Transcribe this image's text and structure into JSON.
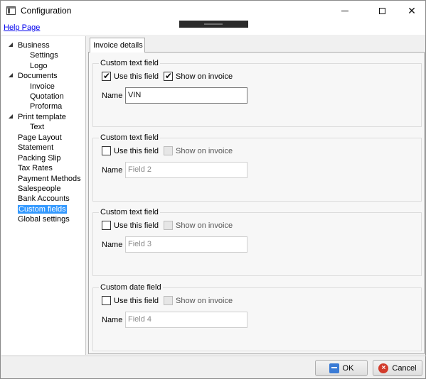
{
  "window": {
    "title": "Configuration",
    "controls": {
      "minimize": "–",
      "maximize": "□",
      "close": "✕"
    }
  },
  "help": {
    "link_label": "Help Page"
  },
  "tree": {
    "items": [
      {
        "label": "Business",
        "level": 0,
        "expanded": true
      },
      {
        "label": "Settings",
        "level": 1
      },
      {
        "label": "Logo",
        "level": 1
      },
      {
        "label": "Documents",
        "level": 0,
        "expanded": true
      },
      {
        "label": "Invoice",
        "level": 1
      },
      {
        "label": "Quotation",
        "level": 1
      },
      {
        "label": "Proforma",
        "level": 1
      },
      {
        "label": "Print template",
        "level": 0,
        "expanded": true
      },
      {
        "label": "Text",
        "level": 1
      },
      {
        "label": "Page Layout",
        "level": 0
      },
      {
        "label": "Statement",
        "level": 0
      },
      {
        "label": "Packing Slip",
        "level": 0
      },
      {
        "label": "Tax Rates",
        "level": 0
      },
      {
        "label": "Payment Methods",
        "level": 0
      },
      {
        "label": "Salespeople",
        "level": 0
      },
      {
        "label": "Bank Accounts",
        "level": 0
      },
      {
        "label": "Custom fields",
        "level": 0,
        "selected": true
      },
      {
        "label": "Global settings",
        "level": 0
      }
    ]
  },
  "tab": {
    "label": "Invoice details"
  },
  "groups": [
    {
      "title": "Custom text field",
      "use_label": "Use this field",
      "use_checked": true,
      "show_label": "Show on invoice",
      "show_checked": true,
      "show_enabled": true,
      "name_label": "Name",
      "name_value": "VIN",
      "name_placeholder": "",
      "enabled": true
    },
    {
      "title": "Custom text field",
      "use_label": "Use this field",
      "use_checked": false,
      "show_label": "Show on invoice",
      "show_checked": false,
      "show_enabled": false,
      "name_label": "Name",
      "name_value": "",
      "name_placeholder": "Field 2",
      "enabled": false
    },
    {
      "title": "Custom text field",
      "use_label": "Use this field",
      "use_checked": false,
      "show_label": "Show on invoice",
      "show_checked": false,
      "show_enabled": false,
      "name_label": "Name",
      "name_value": "",
      "name_placeholder": "Field 3",
      "enabled": false
    },
    {
      "title": "Custom date field",
      "use_label": "Use this field",
      "use_checked": false,
      "show_label": "Show on invoice",
      "show_checked": false,
      "show_enabled": false,
      "name_label": "Name",
      "name_value": "",
      "name_placeholder": "Field 4",
      "enabled": false
    }
  ],
  "buttons": {
    "ok_label": "OK",
    "cancel_label": "Cancel"
  },
  "icons": {
    "app": "window-icon",
    "ok": "save-disk-icon",
    "cancel": "cancel-circle-icon",
    "check": "✔",
    "expander": "triangle-expanded-icon"
  },
  "colors": {
    "selection": "#3399ff",
    "link": "#0000ee",
    "cancel": "#d23b2b",
    "ok": "#3a7bd5"
  }
}
